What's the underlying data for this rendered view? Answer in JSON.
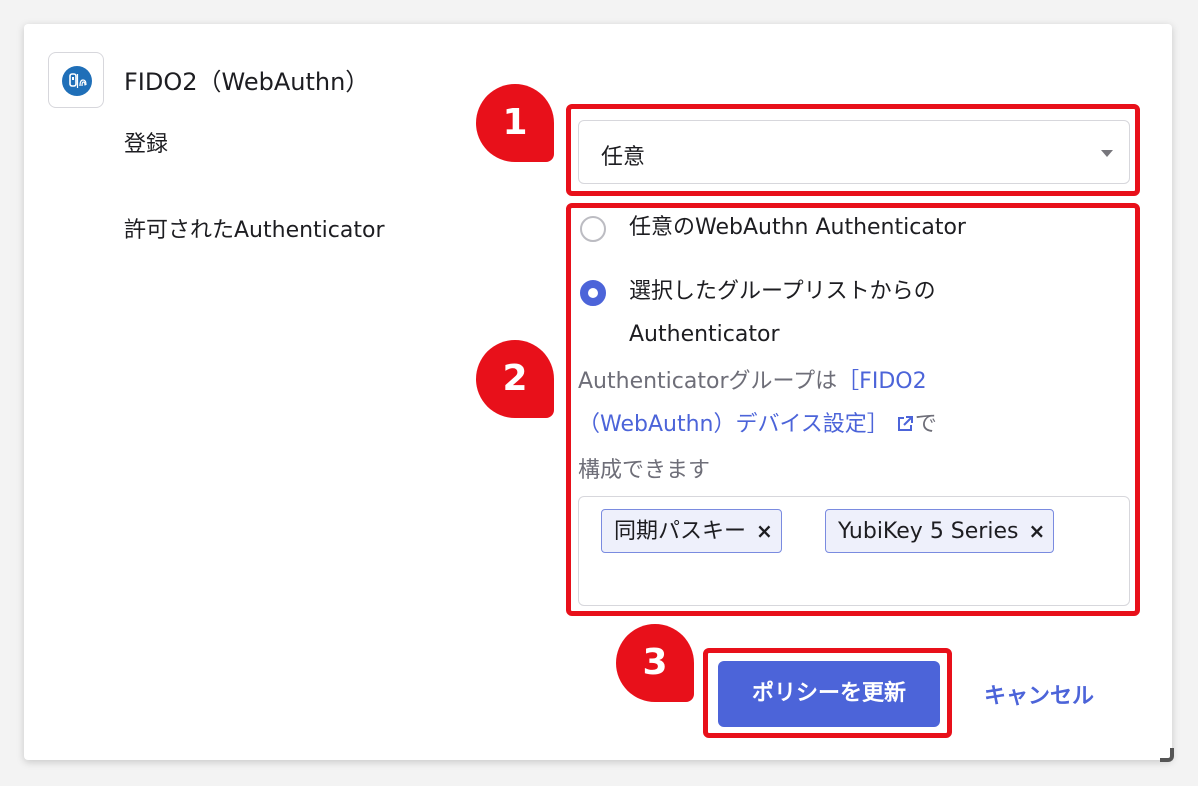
{
  "app": {
    "title": "FIDO2（WebAuthn）",
    "icon": "fido-key-fingerprint-icon"
  },
  "enrollment": {
    "label": "登録",
    "selected": "任意"
  },
  "allowed_authenticators": {
    "label": "許可されたAuthenticator",
    "options": [
      {
        "label": "任意のWebAuthn Authenticator",
        "selected": false
      },
      {
        "label_line1": "選択したグループリストからの",
        "label_line2": "Authenticator",
        "selected": true
      }
    ],
    "help": {
      "prefix": "Authenticatorグループは",
      "link_line1": "［FIDO2",
      "link_line2": "（WebAuthn）デバイス設定］",
      "suffix_line2": "で",
      "line3": "構成できます"
    },
    "tags": [
      "同期パスキー",
      "YubiKey 5 Series"
    ],
    "tag_remove_glyph": "×"
  },
  "actions": {
    "update_label": "ポリシーを更新",
    "cancel_label": "キャンセル"
  },
  "callouts": [
    "1",
    "2",
    "3"
  ],
  "colors": {
    "accent": "#4c64d9",
    "highlight": "#e8101a",
    "icon_blue": "#1f6fb8"
  }
}
